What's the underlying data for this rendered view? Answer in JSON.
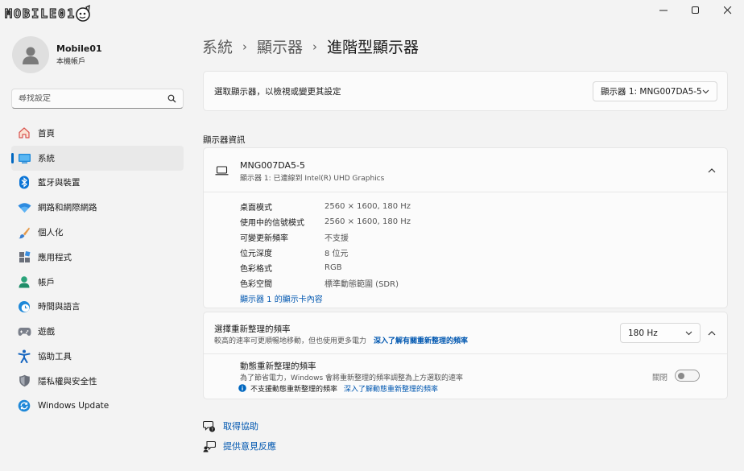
{
  "window": {
    "logo_text": "MOBILE01",
    "controls": [
      "minimize-icon",
      "maximize-icon",
      "close-icon"
    ]
  },
  "profile": {
    "name": "Mobile01",
    "account_type": "本機帳戶"
  },
  "search": {
    "placeholder": "尋找設定"
  },
  "sidebar": {
    "items": [
      {
        "label": "首頁",
        "icon": "home-icon",
        "active": false
      },
      {
        "label": "系統",
        "icon": "system-icon",
        "active": true
      },
      {
        "label": "藍牙與裝置",
        "icon": "bluetooth-icon",
        "active": false
      },
      {
        "label": "網路和網際網路",
        "icon": "network-icon",
        "active": false
      },
      {
        "label": "個人化",
        "icon": "brush-icon",
        "active": false
      },
      {
        "label": "應用程式",
        "icon": "apps-icon",
        "active": false
      },
      {
        "label": "帳戶",
        "icon": "account-icon",
        "active": false
      },
      {
        "label": "時間與語言",
        "icon": "time-language-icon",
        "active": false
      },
      {
        "label": "遊戲",
        "icon": "gaming-icon",
        "active": false
      },
      {
        "label": "協助工具",
        "icon": "accessibility-icon",
        "active": false
      },
      {
        "label": "隱私權與安全性",
        "icon": "shield-icon",
        "active": false
      },
      {
        "label": "Windows Update",
        "icon": "windows-update-icon",
        "active": false
      }
    ]
  },
  "breadcrumb": {
    "items": [
      "系統",
      "顯示器",
      "進階型顯示器"
    ]
  },
  "select_display": {
    "label": "選取顯示器，以檢視或變更其設定",
    "value": "顯示器 1: MNG007DA5-5"
  },
  "display_info": {
    "section_title": "顯示器資訊",
    "name": "MNG007DA5-5",
    "subtitle": "顯示器 1: 已連線到 Intel(R) UHD Graphics",
    "rows": [
      {
        "label": "桌面模式",
        "value": "2560 × 1600, 180 Hz"
      },
      {
        "label": "使用中的信號模式",
        "value": "2560 × 1600, 180 Hz"
      },
      {
        "label": "可變更新頻率",
        "value": "不支援"
      },
      {
        "label": "位元深度",
        "value": "8 位元"
      },
      {
        "label": "色彩格式",
        "value": "RGB"
      },
      {
        "label": "色彩空間",
        "value": "標準動態範圍 (SDR)"
      }
    ],
    "adapter_link": "顯示器 1 的顯示卡內容"
  },
  "refresh_rate": {
    "title": "選擇重新整理的頻率",
    "description": "較高的速率可更順暢地移動，但也使用更多電力",
    "learn_more": "深入了解有關重新整理的頻率",
    "value": "180 Hz"
  },
  "dynamic_refresh": {
    "title": "動態重新整理的頻率",
    "description": "為了節省電力，Windows 會將重新整理的頻率調整為上方選取的速率",
    "toggle_label": "關閉",
    "toggle_on": false,
    "unsupported": "不支援動態重新整理的頻率",
    "learn_more": "深入了解動態重新整理的頻率"
  },
  "help": {
    "get_help": "取得協助",
    "feedback": "提供意見反應"
  },
  "colors": {
    "accent": "#0067c0",
    "link": "#0057b0",
    "background": "#f3f3f3",
    "card": "#fbfbfb"
  }
}
